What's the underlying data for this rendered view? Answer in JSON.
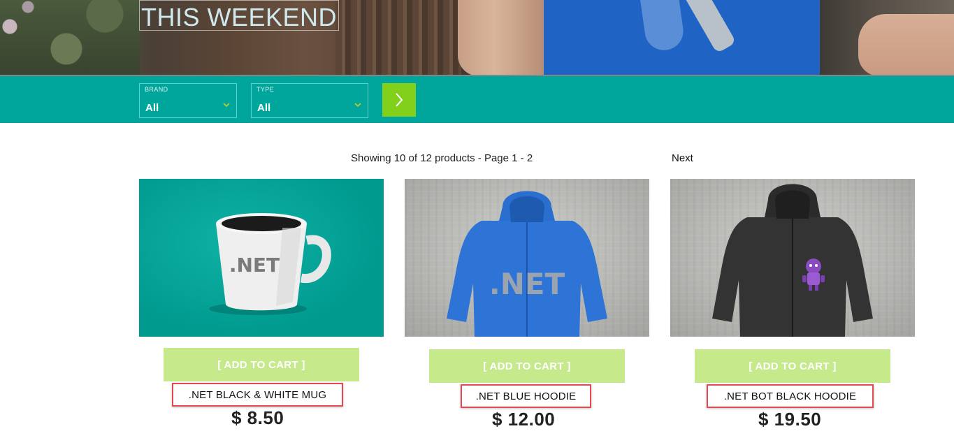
{
  "hero": {
    "title": "THIS WEEKEND"
  },
  "filters": {
    "brand": {
      "label": "BRAND",
      "value": "All"
    },
    "type": {
      "label": "TYPE",
      "value": "All"
    },
    "go_icon": "chevron-right-icon"
  },
  "pager": {
    "summary": "Showing 10 of 12 products - Page 1 - 2",
    "next_label": "Next"
  },
  "products": [
    {
      "name": ".NET BLACK & WHITE MUG",
      "price": "$ 8.50",
      "add_label": "[ ADD TO CART ]",
      "image": "mug-image"
    },
    {
      "name": ".NET BLUE HOODIE",
      "price": "$ 12.00",
      "add_label": "[ ADD TO CART ]",
      "image": "blue-hoodie-image"
    },
    {
      "name": ".NET BOT BLACK HOODIE",
      "price": "$ 19.50",
      "add_label": "[ ADD TO CART ]",
      "image": "black-hoodie-image"
    }
  ],
  "colors": {
    "filter_bar": "#00a69c",
    "go_button": "#83d01b",
    "add_button": "#c6e98c",
    "highlight_border": "#e04a50"
  }
}
